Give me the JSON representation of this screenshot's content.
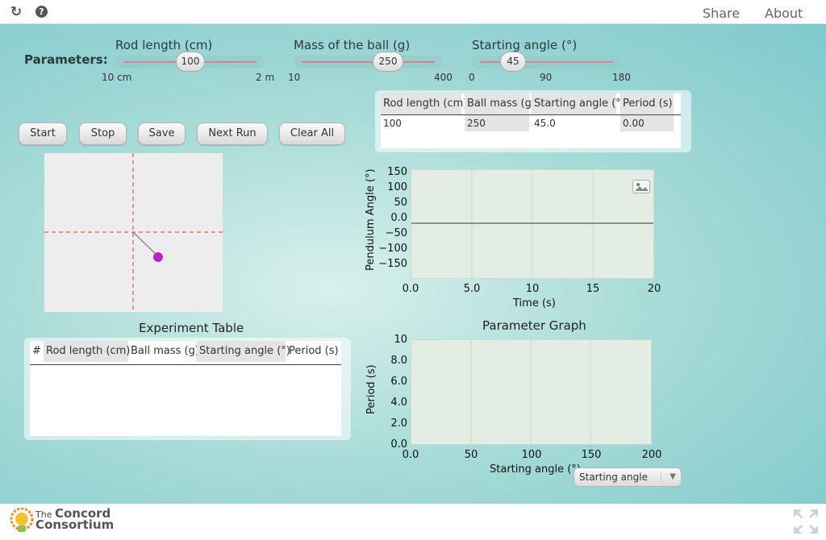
{
  "topbar": {
    "share": "Share",
    "about": "About"
  },
  "parameters": {
    "title": "Parameters:",
    "rod": {
      "label": "Rod length (cm)",
      "value": "100",
      "min": "10 cm",
      "max": "2 m"
    },
    "mass": {
      "label": "Mass of the ball (g)",
      "value": "250",
      "min": "10",
      "max": "400"
    },
    "angle": {
      "label": "Starting angle (°)",
      "value": "45",
      "min": "0",
      "mid": "90",
      "max": "180"
    }
  },
  "buttons": {
    "start": "Start",
    "stop": "Stop",
    "save": "Save",
    "next_run": "Next Run",
    "clear_all": "Clear All"
  },
  "current_table": {
    "headers": [
      "Rod length (cm)",
      "Ball mass (g)",
      "Starting angle (°)",
      "Period (s)"
    ],
    "row": [
      "100",
      "250",
      "45.0",
      "0.00"
    ]
  },
  "experiment_table": {
    "title": "Experiment Table",
    "headers": [
      "#",
      "Rod length (cm)",
      "Ball mass (g)",
      "Starting angle (°)",
      "Period (s)"
    ]
  },
  "time_graph": {
    "ylabel": "Pendulum Angle (°)",
    "xlabel": "Time (s)",
    "yticks": [
      "150",
      "100",
      "50",
      "0.0",
      "−50",
      "−100",
      "−150"
    ],
    "xticks": [
      "0.0",
      "5.0",
      "10",
      "15",
      "20"
    ]
  },
  "param_graph": {
    "title": "Parameter Graph",
    "ylabel": "Period (s)",
    "xlabel": "Starting angle (°)",
    "yticks": [
      "10",
      "8.0",
      "6.0",
      "4.0",
      "2.0",
      "0.0"
    ],
    "xticks": [
      "0.0",
      "50",
      "100",
      "150",
      "200"
    ],
    "select_value": "Starting angle"
  },
  "chart_data": [
    {
      "type": "line",
      "xlabel": "Time (s)",
      "ylabel": "Pendulum Angle (°)",
      "xlim": [
        0,
        20
      ],
      "ylim": [
        -150,
        150
      ],
      "series": []
    },
    {
      "type": "scatter",
      "title": "Parameter Graph",
      "xlabel": "Starting angle (°)",
      "ylabel": "Period (s)",
      "xlim": [
        0,
        200
      ],
      "ylim": [
        0,
        10
      ],
      "series": []
    }
  ],
  "footer": {
    "logo_small": "The",
    "logo_line1": "Concord",
    "logo_line2": "Consortium"
  },
  "colors": {
    "accent": "#b22bc0",
    "crosshair": "#e0353c",
    "background": "#a9dcd8"
  }
}
